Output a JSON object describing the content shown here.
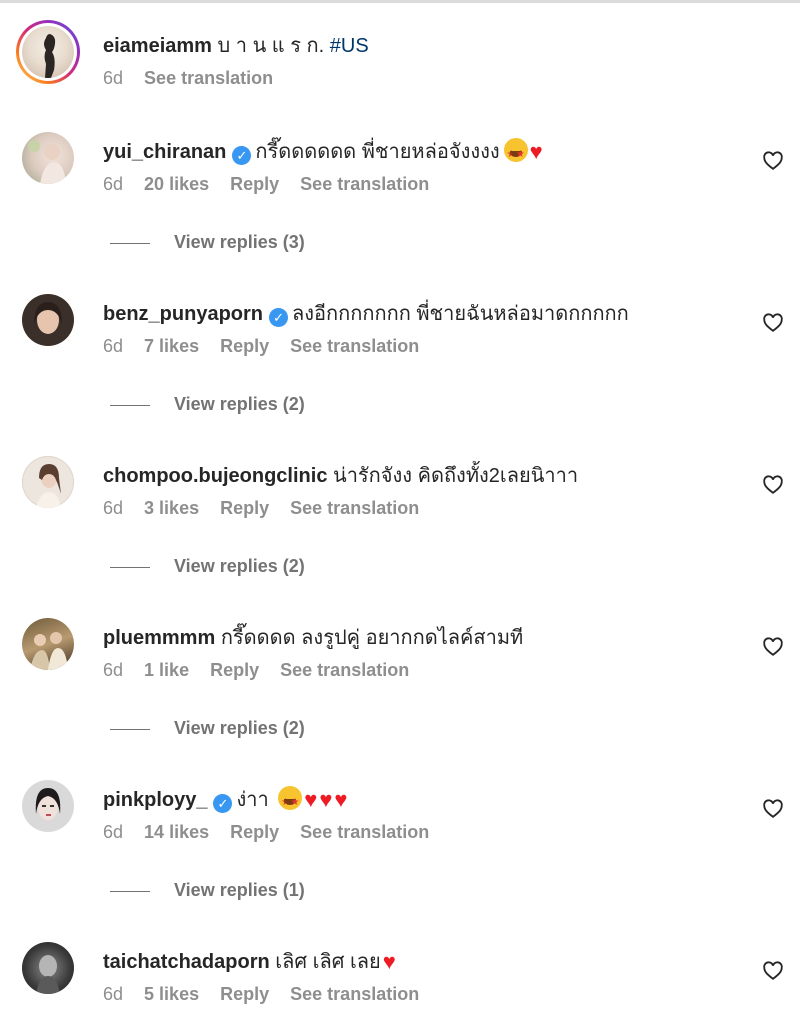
{
  "comments": [
    {
      "username": "eiameiamm",
      "text": "บ า น แ ร ก.",
      "hashtag": "#US",
      "time": "6d",
      "likes": "",
      "reply": "",
      "translate": "See translation",
      "verified": false,
      "view_replies": ""
    },
    {
      "username": "yui_chiranan",
      "text": "กรี๊ดดดดดด พี่ชายหล่อจังงงง",
      "time": "6d",
      "likes": "20 likes",
      "reply": "Reply",
      "translate": "See translation",
      "verified": true,
      "view_replies": "View replies (3)"
    },
    {
      "username": "benz_punyaporn",
      "text": "ลงอีกกกกกกก พี่ชายฉันหล่อมาดกกกกก",
      "time": "6d",
      "likes": "7 likes",
      "reply": "Reply",
      "translate": "See translation",
      "verified": true,
      "view_replies": "View replies (2)"
    },
    {
      "username": "chompoo.bujeongclinic",
      "text": "น่ารักจังง คิดถึงทั้ง2เลยนิาาา",
      "time": "6d",
      "likes": "3 likes",
      "reply": "Reply",
      "translate": "See translation",
      "verified": false,
      "view_replies": "View replies (2)"
    },
    {
      "username": "pluemmmm",
      "text": "กรี๊ดดดด ลงรูปคู่ อยากกดไลค์สามที",
      "time": "6d",
      "likes": "1 like",
      "reply": "Reply",
      "translate": "See translation",
      "verified": false,
      "view_replies": "View replies (2)"
    },
    {
      "username": "pinkployy_",
      "text": "ง่าา",
      "time": "6d",
      "likes": "14 likes",
      "reply": "Reply",
      "translate": "See translation",
      "verified": true,
      "view_replies": "View replies (1)"
    },
    {
      "username": "taichatchadaporn",
      "text": "เลิศ เลิศ เลย",
      "time": "6d",
      "likes": "5 likes",
      "reply": "Reply",
      "translate": "See translation",
      "verified": false,
      "view_replies": ""
    }
  ],
  "icons": {
    "verified": "verified-badge-icon",
    "like": "heart-outline-icon",
    "emoji_heart": "red-heart-emoji",
    "emoji_face": "star-struck-emoji"
  },
  "colors": {
    "verified": "#3897f0",
    "hashtag": "#00376b",
    "meta": "#8e8e8e",
    "heart_emoji": "#ed1c24"
  }
}
